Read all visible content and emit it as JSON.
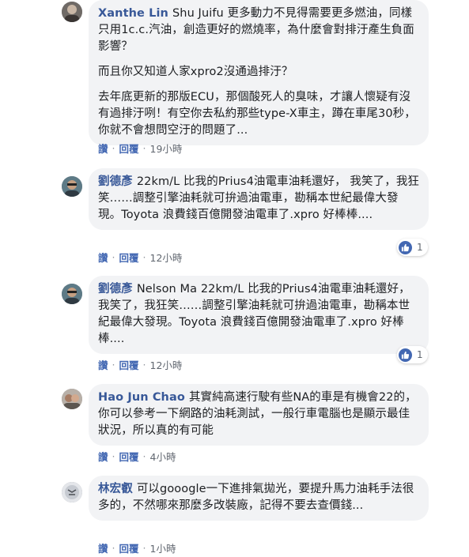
{
  "actions": {
    "like": "讚",
    "reply": "回覆",
    "separator": "·"
  },
  "colors": {
    "link": "#385898",
    "action": "#4267b2",
    "bubble": "#f2f3f5",
    "like_badge": "#4267b2"
  },
  "comments": [
    {
      "author": "Xanthe Lin",
      "mention": "Shu Juifu",
      "paragraphs": [
        "Shu Juifu 更多動力不見得需要更多燃油，同樣只用1c.c.汽油，創造更好的燃燒率，為什麼會對排汙產生負面影響？",
        "而且你又知道人家xpro2沒通過排汙？",
        "去年底更新的那版ECU，那個酸死人的臭味，才讓人懷疑有沒有過排汙咧！有空你去私約那些type-X車主，蹲在車尾30秒，你就不會想問空汙的問題了..."
      ],
      "time": "19小時",
      "reactions": null,
      "avatar_icon": "profile-photo"
    },
    {
      "author": "劉德彥",
      "paragraphs": [
        "22km/L 比我的Prius4油電車油耗還好， 我笑了，我狂笑……調整引擎油耗就可拚過油電車，勘稱本世紀最偉大發現。Toyota 浪費錢百億開發油電車了.xpro 好棒棒...."
      ],
      "time": "12小時",
      "reactions": {
        "icon": "like-icon",
        "count": "1"
      },
      "avatar_icon": "profile-photo"
    },
    {
      "author": "劉德彥",
      "paragraphs": [
        "Nelson Ma 22km/L 比我的Prius4油電車油耗還好， 我笑了，我狂笑……調整引擎油耗就可拚過油電車，勘稱本世紀最偉大發現。Toyota 浪費錢百億開發油電車了.xpro 好棒棒...."
      ],
      "time": "12小時",
      "reactions": {
        "icon": "like-icon",
        "count": "1"
      },
      "avatar_icon": "profile-photo"
    },
    {
      "author": "Hao Jun Chao",
      "paragraphs": [
        "其實純高速行駛有些NA的車是有機會22的，你可以參考一下網路的油耗測試，一般行車電腦也是顯示最佳狀況，所以真的有可能"
      ],
      "time": "4小時",
      "reactions": null,
      "avatar_icon": "profile-photo"
    },
    {
      "author": "林宏叡",
      "paragraphs": [
        "可以gooogle一下進排氣拋光，要提升馬力油耗手法很多的，不然哪來那麼多改裝廠，記得不要去查價錢..."
      ],
      "time": "1小時",
      "reactions": null,
      "avatar_icon": "profile-photo"
    }
  ]
}
